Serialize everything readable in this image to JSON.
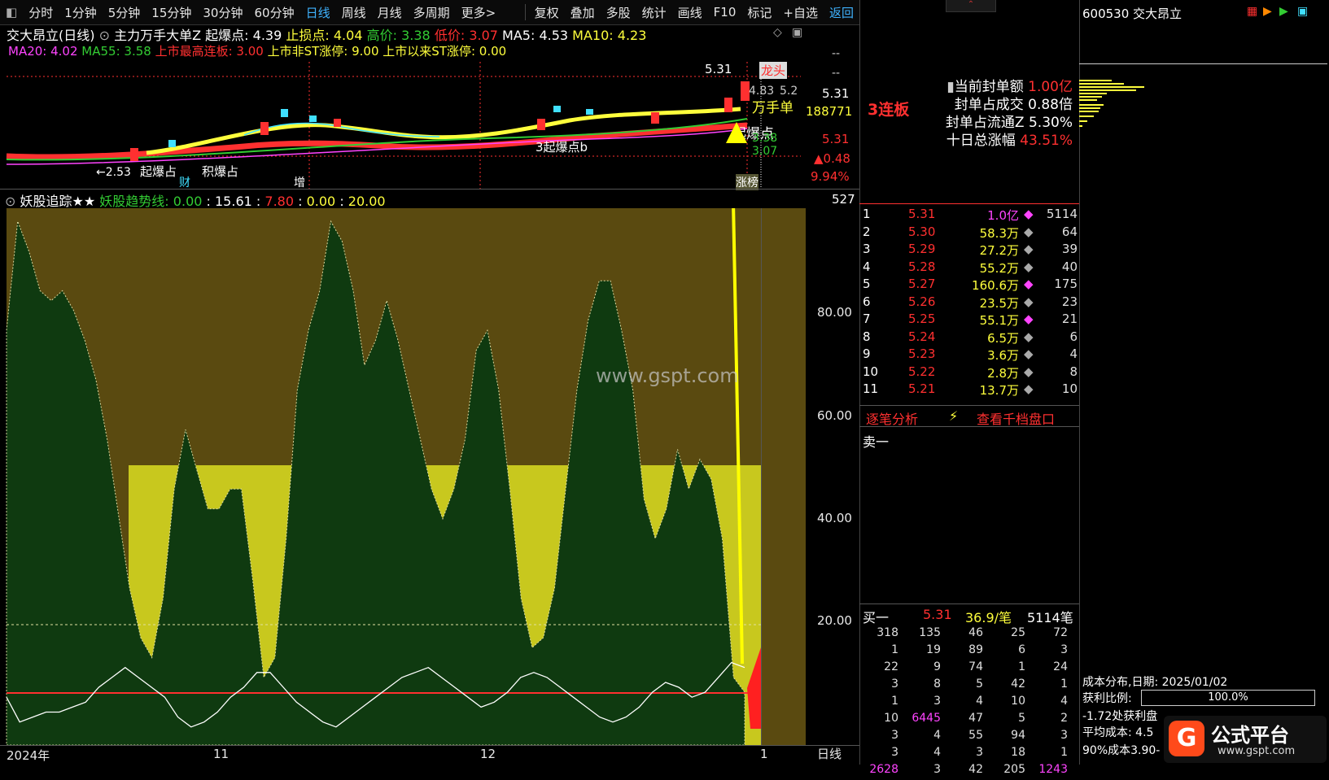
{
  "toolbar": {
    "periods": [
      "分时",
      "1分钟",
      "5分钟",
      "15分钟",
      "30分钟",
      "60分钟",
      "日线",
      "周线",
      "月线",
      "多周期",
      "更多>"
    ],
    "active_period": "日线",
    "tools": [
      "复权",
      "叠加",
      "多股",
      "统计",
      "画线",
      "F10",
      "标记",
      "+自选",
      "返回"
    ]
  },
  "header": {
    "stock_title": "交大昂立(日线)",
    "main_label": "主力万手大单Z",
    "qibao_label": "起爆点:",
    "qibao_value": "4.39",
    "zhisun_label": "止损点:",
    "zhisun_value": "4.04",
    "high_label": "高价:",
    "high_value": "3.38",
    "low_label": "低价:",
    "low_value": "3.07",
    "ma5_label": "MA5:",
    "ma5_value": "4.53",
    "ma10_label": "MA10:",
    "ma10_value": "4.23",
    "ma20": "MA20: 4.02",
    "ma55": "MA55: 3.58",
    "max_board": "上市最高连板: 3.00",
    "non_st": "上市非ST涨停: 9.00",
    "st_limit": "上市以来ST涨停: 0.00"
  },
  "kline_annotations": {
    "price_top": "5.31",
    "longtou": "龙头",
    "ptag1": "4.83",
    "ptag2": "5.2",
    "wanshou": "万手单",
    "qibao": "起爆点",
    "qibao2": "3起爆点b",
    "left1": "←2.53",
    "left2": "起爆占",
    "left3": "积爆占",
    "cai": "财",
    "zeng": "增",
    "zhangting": "涨榜"
  },
  "kline_axis": {
    "v1": "--",
    "v2": "--",
    "v3": "5.31",
    "v4": "188771",
    "v5": "5.31",
    "v6": "3.38",
    "v7": "3.07",
    "v8": "▲0.48",
    "v9": "9.94%"
  },
  "indicator": {
    "name": "妖股追踪★★",
    "trend_label": "妖股趋势线:",
    "v1": "0.00",
    "v2": "15.61",
    "v3": "7.80",
    "v4": "0.00",
    "v5": "20.00",
    "vol_top": "527"
  },
  "y_axis": [
    "80.00",
    "60.00",
    "40.00",
    "20.00"
  ],
  "x_axis": [
    "2024年",
    "11",
    "12",
    "1"
  ],
  "x_axis_right": "日线",
  "watermark": "www.gspt.com",
  "chart_data": {
    "type": "area",
    "title": "妖股追踪",
    "ylim": [
      0,
      105
    ],
    "x": [
      0,
      1,
      2,
      3,
      4,
      5,
      6,
      7,
      8,
      9,
      10,
      11,
      12,
      13,
      14,
      15,
      16,
      17,
      18,
      19,
      20,
      21,
      22,
      23,
      24,
      25,
      26,
      27,
      28,
      29,
      30,
      31,
      32,
      33,
      34,
      35,
      36,
      37,
      38,
      39,
      40,
      41,
      42,
      43,
      44,
      45,
      46,
      47,
      48,
      49,
      50,
      51,
      52,
      53,
      54,
      55,
      56,
      57,
      58,
      59,
      60,
      61,
      62,
      63,
      64,
      65,
      66,
      67,
      68,
      69,
      70,
      71,
      72,
      73,
      74,
      75,
      76,
      77,
      78,
      79,
      80,
      81,
      82,
      83,
      84,
      85,
      86,
      87,
      88,
      89,
      90,
      91,
      92,
      93,
      94,
      95
    ],
    "series": [
      {
        "name": "妖股趋势线",
        "values": [
          82,
          104,
          98,
          90,
          88,
          90,
          86,
          80,
          72,
          60,
          45,
          30,
          20,
          16,
          28,
          50,
          62,
          54,
          46,
          46,
          50,
          50,
          32,
          12,
          16,
          40,
          70,
          82,
          90,
          104,
          100,
          90,
          75,
          80,
          88,
          80,
          70,
          60,
          50,
          44,
          50,
          60,
          78,
          82,
          70,
          50,
          28,
          18,
          20,
          30,
          50,
          70,
          84,
          92,
          92,
          82,
          70,
          48,
          40,
          46,
          58,
          50,
          56,
          52,
          40,
          12,
          9
        ]
      },
      {
        "name": "白线",
        "values": [
          8,
          3,
          4,
          5,
          5,
          6,
          7,
          10,
          12,
          14,
          12,
          10,
          8,
          4,
          2,
          3,
          5,
          8,
          10,
          13,
          13,
          10,
          7,
          5,
          3,
          2,
          4,
          6,
          8,
          10,
          12,
          13,
          14,
          12,
          10,
          8,
          6,
          7,
          9,
          12,
          13,
          12,
          10,
          8,
          6,
          4,
          3,
          4,
          6,
          9,
          11,
          10,
          8,
          9,
          12,
          15,
          14
        ]
      }
    ]
  },
  "orderbook": {
    "rows": [
      {
        "n": "1",
        "price": "5.31",
        "vol": "1.0亿",
        "cnt": "5114"
      },
      {
        "n": "2",
        "price": "5.30",
        "vol": "58.3万",
        "cnt": "64"
      },
      {
        "n": "3",
        "price": "5.29",
        "vol": "27.2万",
        "cnt": "39"
      },
      {
        "n": "4",
        "price": "5.28",
        "vol": "55.2万",
        "cnt": "40"
      },
      {
        "n": "5",
        "price": "5.27",
        "vol": "160.6万",
        "cnt": "175"
      },
      {
        "n": "6",
        "price": "5.26",
        "vol": "23.5万",
        "cnt": "23"
      },
      {
        "n": "7",
        "price": "5.25",
        "vol": "55.1万",
        "cnt": "21"
      },
      {
        "n": "8",
        "price": "5.24",
        "vol": "6.5万",
        "cnt": "6"
      },
      {
        "n": "9",
        "price": "5.23",
        "vol": "3.6万",
        "cnt": "4"
      },
      {
        "n": "10",
        "price": "5.22",
        "vol": "2.8万",
        "cnt": "8"
      },
      {
        "n": "11",
        "price": "5.21",
        "vol": "13.7万",
        "cnt": "10"
      }
    ],
    "zhubi": "逐笔分析",
    "qiandang": "查看千档盘口",
    "sell1": "卖一",
    "buy1": "买一",
    "buy1_price": "5.31",
    "buy1_avg": "36.9/笔",
    "buy1_cnt": "5114笔"
  },
  "deals": [
    [
      "318",
      "135",
      "46",
      "25",
      "72"
    ],
    [
      "1",
      "19",
      "89",
      "6",
      "3"
    ],
    [
      "22",
      "9",
      "74",
      "1",
      "24"
    ],
    [
      "3",
      "8",
      "5",
      "42",
      "1"
    ],
    [
      "1",
      "3",
      "4",
      "10",
      "4"
    ],
    [
      "10",
      "6445",
      "47",
      "5",
      "2"
    ],
    [
      "3",
      "4",
      "55",
      "94",
      "3"
    ],
    [
      "3",
      "4",
      "3",
      "18",
      "1"
    ],
    [
      "2628",
      "3",
      "42",
      "205",
      "1243"
    ]
  ],
  "board_info": {
    "lianban": "3连板",
    "l1": "当前封单额",
    "v1": "1.00亿",
    "l2": "封单占成交",
    "v2": "0.88倍",
    "l3": "封单占流通Z",
    "v3": "5.30%",
    "l4": "十日总涨幅",
    "v4": "43.51%"
  },
  "far_right": {
    "code": "600530 交大昂立",
    "cost_date": "成本分布,日期: 2025/01/02",
    "profit_label": "获利比例:",
    "profit_value": "100.0%",
    "profit_note": "-1.72处获利盘",
    "avg_cost": "平均成本: 4.5",
    "cost90": "90%成本3.90-",
    "brand": "公式平台",
    "brand_url": "www.gspt.com"
  },
  "colors": {
    "red": "#ff3030",
    "yellow": "#ffff3c",
    "cyan": "#40e0ff",
    "green": "#33cc33",
    "magenta": "#ff44ff",
    "olive": "#5a4a10",
    "darkgreen": "#0f3a10",
    "yellowfill": "#c8c81e"
  }
}
